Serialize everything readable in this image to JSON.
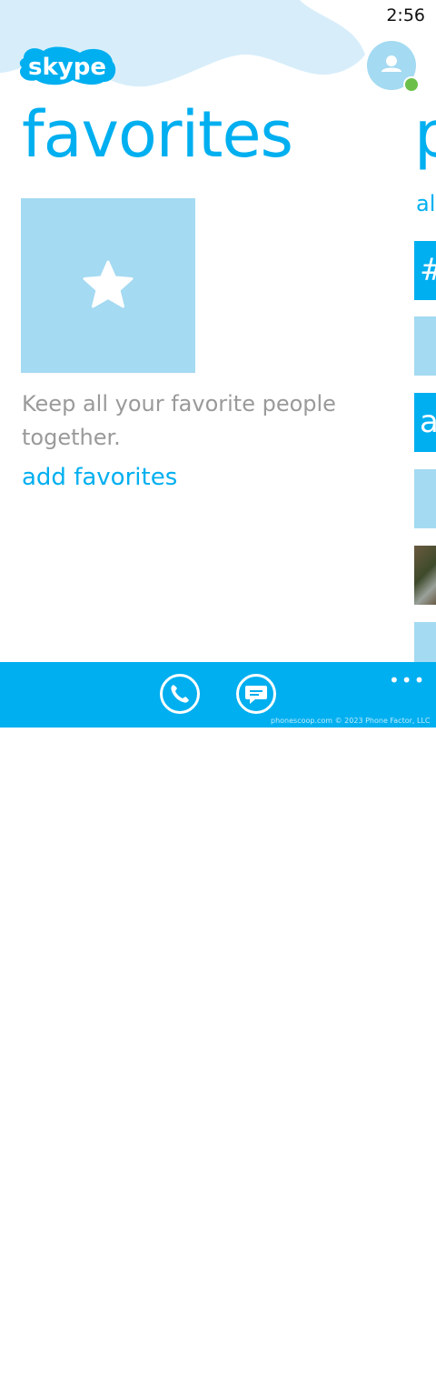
{
  "status_bar": {
    "time": "2:56"
  },
  "header": {
    "logo_text": "skype",
    "profile_icon": "person-icon",
    "presence_color": "#6cc04a"
  },
  "favorites_panel": {
    "title": "favorites",
    "tile_icon": "star-icon",
    "empty_message": "Keep all your favorite people together.",
    "add_link": "add favorites"
  },
  "people_panel_peek": {
    "title_fragment": "p",
    "filter_fragment": "al",
    "group_tiles": [
      "#",
      "a"
    ]
  },
  "app_bar": {
    "buttons": [
      "phone-icon",
      "chat-icon"
    ],
    "more_icon": "ellipsis-icon"
  },
  "watermark": {
    "line1": "Phone",
    "line2": "scoop",
    "footer": "phonescoop.com  © 2023 Phone Factor, LLC"
  },
  "colors": {
    "accent": "#00aff0",
    "tile_light": "#a4daf2",
    "cloud": "#d7eefa",
    "text_muted": "#9a9a9a"
  }
}
